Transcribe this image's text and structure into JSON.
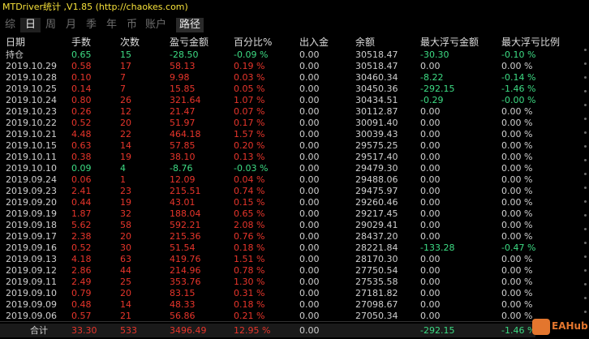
{
  "title": "MTDriver统计 ,V1.85 (http://chaokes.com)",
  "tabs": [
    "综",
    "日",
    "周",
    "月",
    "季",
    "年",
    "币",
    "账户",
    "路径"
  ],
  "headers": [
    "日期",
    "手数",
    "次数",
    "盈亏金额",
    "百分比%",
    "出入金",
    "余额",
    "最大浮亏金额",
    "最大浮亏比例"
  ],
  "colors": {
    "positive": "#3ddc84",
    "negative": "#e8352b",
    "neutral": "#cfcfcf",
    "title": "#f6e13a"
  },
  "rows": [
    {
      "c": [
        "持仓",
        "0.65",
        "15",
        "-28.50",
        "-0.09 %",
        "0.00",
        "30518.47",
        "-30.30",
        "-0.10 %"
      ],
      "k": [
        "n",
        "g",
        "g",
        "g",
        "g",
        "n",
        "n",
        "g",
        "g"
      ]
    },
    {
      "c": [
        "2019.10.29",
        "0.58",
        "17",
        "58.13",
        "0.19 %",
        "0.00",
        "30518.47",
        "0.00",
        "0.00 %"
      ],
      "k": [
        "n",
        "r",
        "r",
        "r",
        "r",
        "n",
        "n",
        "n",
        "n"
      ]
    },
    {
      "c": [
        "2019.10.28",
        "0.10",
        "7",
        "9.98",
        "0.03 %",
        "0.00",
        "30460.34",
        "-8.22",
        "-0.14 %"
      ],
      "k": [
        "n",
        "r",
        "r",
        "r",
        "r",
        "n",
        "n",
        "g",
        "g"
      ]
    },
    {
      "c": [
        "2019.10.25",
        "0.14",
        "7",
        "15.85",
        "0.05 %",
        "0.00",
        "30450.36",
        "-292.15",
        "-1.46 %"
      ],
      "k": [
        "n",
        "r",
        "r",
        "r",
        "r",
        "n",
        "n",
        "g",
        "g"
      ]
    },
    {
      "c": [
        "2019.10.24",
        "0.80",
        "26",
        "321.64",
        "1.07 %",
        "0.00",
        "30434.51",
        "-0.29",
        "-0.00 %"
      ],
      "k": [
        "n",
        "r",
        "r",
        "r",
        "r",
        "n",
        "n",
        "g",
        "g"
      ]
    },
    {
      "c": [
        "2019.10.23",
        "0.26",
        "12",
        "21.47",
        "0.07 %",
        "0.00",
        "30112.87",
        "0.00",
        "0.00 %"
      ],
      "k": [
        "n",
        "r",
        "r",
        "r",
        "r",
        "n",
        "n",
        "n",
        "n"
      ]
    },
    {
      "c": [
        "2019.10.22",
        "0.52",
        "20",
        "51.97",
        "0.17 %",
        "0.00",
        "30091.40",
        "0.00",
        "0.00 %"
      ],
      "k": [
        "n",
        "r",
        "r",
        "r",
        "r",
        "n",
        "n",
        "n",
        "n"
      ]
    },
    {
      "c": [
        "2019.10.21",
        "4.48",
        "22",
        "464.18",
        "1.57 %",
        "0.00",
        "30039.43",
        "0.00",
        "0.00 %"
      ],
      "k": [
        "n",
        "r",
        "r",
        "r",
        "r",
        "n",
        "n",
        "n",
        "n"
      ]
    },
    {
      "c": [
        "2019.10.15",
        "0.63",
        "14",
        "57.85",
        "0.20 %",
        "0.00",
        "29575.25",
        "0.00",
        "0.00 %"
      ],
      "k": [
        "n",
        "r",
        "r",
        "r",
        "r",
        "n",
        "n",
        "n",
        "n"
      ]
    },
    {
      "c": [
        "2019.10.11",
        "0.38",
        "19",
        "38.10",
        "0.13 %",
        "0.00",
        "29517.40",
        "0.00",
        "0.00 %"
      ],
      "k": [
        "n",
        "r",
        "r",
        "r",
        "r",
        "n",
        "n",
        "n",
        "n"
      ]
    },
    {
      "c": [
        "2019.10.10",
        "0.09",
        "4",
        "-8.76",
        "-0.03 %",
        "0.00",
        "29479.30",
        "0.00",
        "0.00 %"
      ],
      "k": [
        "n",
        "g",
        "g",
        "g",
        "g",
        "n",
        "n",
        "n",
        "n"
      ]
    },
    {
      "c": [
        "2019.09.24",
        "0.06",
        "1",
        "12.09",
        "0.04 %",
        "0.00",
        "29488.06",
        "0.00",
        "0.00 %"
      ],
      "k": [
        "n",
        "r",
        "r",
        "r",
        "r",
        "n",
        "n",
        "n",
        "n"
      ]
    },
    {
      "c": [
        "2019.09.23",
        "2.41",
        "23",
        "215.51",
        "0.74 %",
        "0.00",
        "29475.97",
        "0.00",
        "0.00 %"
      ],
      "k": [
        "n",
        "r",
        "r",
        "r",
        "r",
        "n",
        "n",
        "n",
        "n"
      ]
    },
    {
      "c": [
        "2019.09.20",
        "0.44",
        "19",
        "43.01",
        "0.15 %",
        "0.00",
        "29260.46",
        "0.00",
        "0.00 %"
      ],
      "k": [
        "n",
        "r",
        "r",
        "r",
        "r",
        "n",
        "n",
        "n",
        "n"
      ]
    },
    {
      "c": [
        "2019.09.19",
        "1.87",
        "32",
        "188.04",
        "0.65 %",
        "0.00",
        "29217.45",
        "0.00",
        "0.00 %"
      ],
      "k": [
        "n",
        "r",
        "r",
        "r",
        "r",
        "n",
        "n",
        "n",
        "n"
      ]
    },
    {
      "c": [
        "2019.09.18",
        "5.62",
        "58",
        "592.21",
        "2.08 %",
        "0.00",
        "29029.41",
        "0.00",
        "0.00 %"
      ],
      "k": [
        "n",
        "r",
        "r",
        "r",
        "r",
        "n",
        "n",
        "n",
        "n"
      ]
    },
    {
      "c": [
        "2019.09.17",
        "2.38",
        "20",
        "215.36",
        "0.76 %",
        "0.00",
        "28437.20",
        "0.00",
        "0.00 %"
      ],
      "k": [
        "n",
        "r",
        "r",
        "r",
        "r",
        "n",
        "n",
        "n",
        "n"
      ]
    },
    {
      "c": [
        "2019.09.16",
        "0.52",
        "30",
        "51.54",
        "0.18 %",
        "0.00",
        "28221.84",
        "-133.28",
        "-0.47 %"
      ],
      "k": [
        "n",
        "r",
        "r",
        "r",
        "r",
        "n",
        "n",
        "g",
        "g"
      ]
    },
    {
      "c": [
        "2019.09.13",
        "4.18",
        "63",
        "419.76",
        "1.51 %",
        "0.00",
        "28170.30",
        "0.00",
        "0.00 %"
      ],
      "k": [
        "n",
        "r",
        "r",
        "r",
        "r",
        "n",
        "n",
        "n",
        "n"
      ]
    },
    {
      "c": [
        "2019.09.12",
        "2.86",
        "44",
        "214.96",
        "0.78 %",
        "0.00",
        "27750.54",
        "0.00",
        "0.00 %"
      ],
      "k": [
        "n",
        "r",
        "r",
        "r",
        "r",
        "n",
        "n",
        "n",
        "n"
      ]
    },
    {
      "c": [
        "2019.09.11",
        "2.49",
        "25",
        "353.76",
        "1.30 %",
        "0.00",
        "27535.58",
        "0.00",
        "0.00 %"
      ],
      "k": [
        "n",
        "r",
        "r",
        "r",
        "r",
        "n",
        "n",
        "n",
        "n"
      ]
    },
    {
      "c": [
        "2019.09.10",
        "0.79",
        "20",
        "83.15",
        "0.31 %",
        "0.00",
        "27181.82",
        "0.00",
        "0.00 %"
      ],
      "k": [
        "n",
        "r",
        "r",
        "r",
        "r",
        "n",
        "n",
        "n",
        "n"
      ]
    },
    {
      "c": [
        "2019.09.09",
        "0.48",
        "14",
        "48.33",
        "0.18 %",
        "0.00",
        "27098.67",
        "0.00",
        "0.00 %"
      ],
      "k": [
        "n",
        "r",
        "r",
        "r",
        "r",
        "n",
        "n",
        "n",
        "n"
      ]
    },
    {
      "c": [
        "2019.09.06",
        "0.57",
        "21",
        "56.86",
        "0.21 %",
        "0.00",
        "27050.34",
        "0.00",
        "0.00 %"
      ],
      "k": [
        "n",
        "r",
        "r",
        "r",
        "r",
        "n",
        "n",
        "n",
        "n"
      ]
    }
  ],
  "total": {
    "c": [
      "合计",
      "33.30",
      "533",
      "3496.49",
      "12.95 %",
      "0.00",
      "",
      "-292.15",
      "-1.46 %"
    ],
    "k": [
      "n",
      "r",
      "r",
      "r",
      "r",
      "n",
      "n",
      "g",
      "g"
    ]
  },
  "watermark": "EAHub"
}
